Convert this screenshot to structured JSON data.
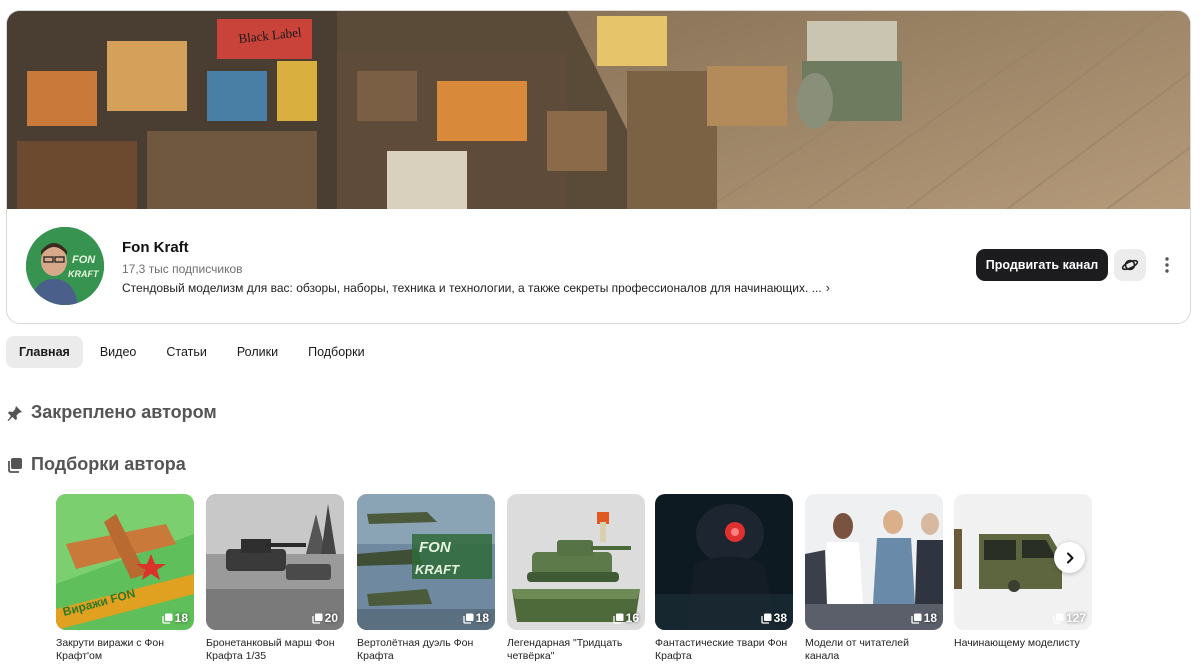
{
  "channel": {
    "name": "Fon Kraft",
    "subscribers": "17,3 тыс подписчиков",
    "description": "Стендовый моделизм для вас: обзоры, наборы, техника и технологии, а также секреты профессионалов для начинающих. ...",
    "avatar_text_top": "FON",
    "avatar_text_bottom": "KRAFT",
    "banner_sign": "Black Label",
    "promote_label": "Продвигать канал"
  },
  "tabs": [
    {
      "label": "Главная",
      "active": true
    },
    {
      "label": "Видео",
      "active": false
    },
    {
      "label": "Статьи",
      "active": false
    },
    {
      "label": "Ролики",
      "active": false
    },
    {
      "label": "Подборки",
      "active": false
    }
  ],
  "sections": {
    "pinned_title": "Закреплено автором",
    "collections_title": "Подборки автора"
  },
  "collections": [
    {
      "title": "Закрути виражи с Фон Крафт'ом",
      "count": "18",
      "overlay_text": "Виражи FON"
    },
    {
      "title": "Бронетанковый марш Фон Крафта 1/35",
      "count": "20"
    },
    {
      "title": "Вертолётная дуэль Фон Крафта",
      "count": "18",
      "overlay_text_top": "FON",
      "overlay_text_bottom": "KRAFT"
    },
    {
      "title": "Легендарная \"Тридцать четвёрка\"",
      "count": "16"
    },
    {
      "title": "Фантастические твари Фон Крафта",
      "count": "38"
    },
    {
      "title": "Модели от читателей канала",
      "count": "18"
    },
    {
      "title": "Начинающему моделисту",
      "count": "127"
    }
  ],
  "icons": {
    "planet": "planet-icon",
    "more": "more-vertical-icon",
    "pin": "pin-icon",
    "collection": "collection-stack-icon",
    "next": "chevron-right-icon"
  },
  "colors": {
    "promote_bg": "#1c1c1e",
    "tab_active_bg": "#ebebeb",
    "section_title": "#555555"
  }
}
